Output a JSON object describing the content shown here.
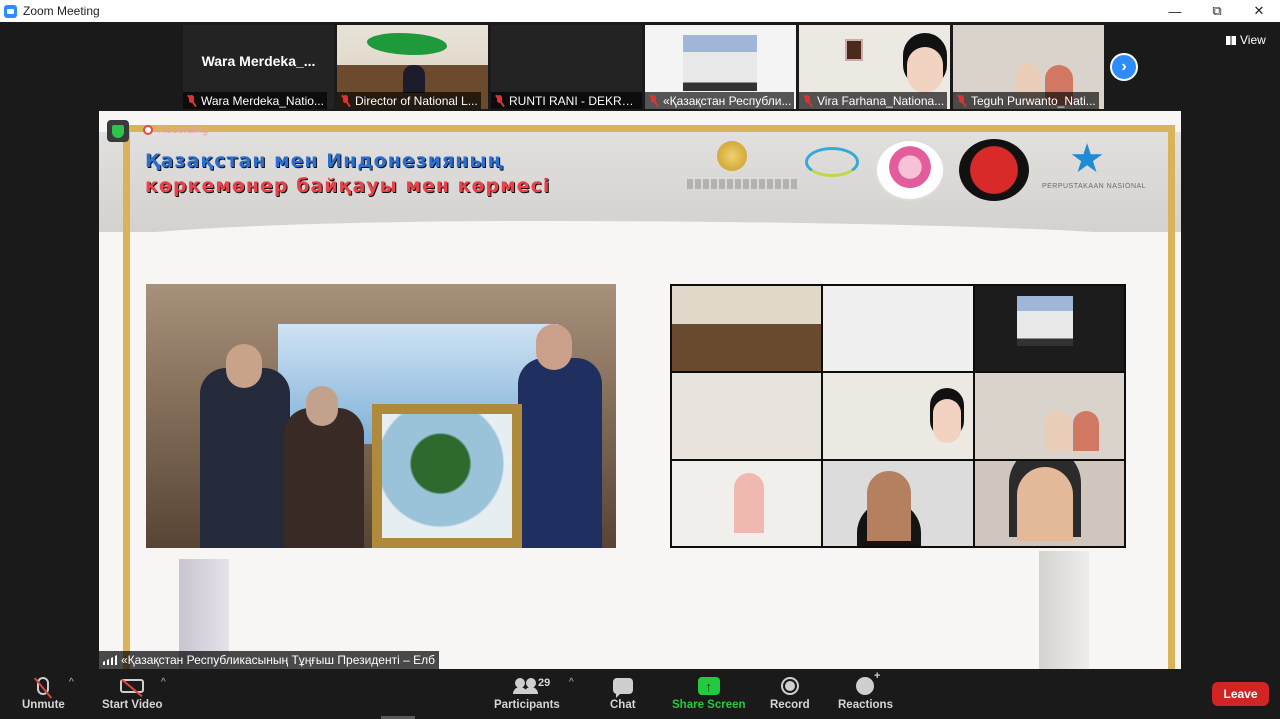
{
  "window": {
    "title": "Zoom Meeting",
    "minimize": "—",
    "restore": "⧉",
    "close": "✕"
  },
  "view": {
    "label": "View",
    "icon": "grid-icon"
  },
  "participants_strip": [
    {
      "name": "Wara Merdeka_Natio...",
      "display_name": "Wara Merdeka_...",
      "video": false
    },
    {
      "name": "Director of National L...",
      "video": true
    },
    {
      "name": "RUNTI RANI - DEKRA...",
      "video": false
    },
    {
      "name": "«Қазақстан Республи...",
      "video": true
    },
    {
      "name": "Vira Farhana_Nationa...",
      "video": true
    },
    {
      "name": "Teguh Purwanto_Nati...",
      "video": true
    }
  ],
  "next_page_icon": "chevron-right-icon",
  "recording": {
    "label": "Recording",
    "icon": "record-dot-icon"
  },
  "encryption_icon": "shield-check-icon",
  "shared_screen": {
    "headline_line1": "Қазақстан мен Индонезияның",
    "headline_line2": "көркемөнер байқауы мен көрмесі",
    "partner_logo_text": "PERPUSTAKAAN NASIONAL",
    "logos": [
      "kazakhstan-emblem-icon",
      "swirl-logo-icon",
      "flower-logo-icon",
      "garuda-seal-icon",
      "star-logo-icon"
    ]
  },
  "active_speaker": {
    "name": "«Қазақстан Республикасының Тұңғыш Президенті – Елб"
  },
  "toolbar": {
    "unmute": "Unmute",
    "start_video": "Start Video",
    "participants": "Participants",
    "participants_count": "29",
    "chat": "Chat",
    "share_screen": "Share Screen",
    "record": "Record",
    "reactions": "Reactions",
    "leave": "Leave",
    "caret": "^"
  },
  "colors": {
    "accent": "#2d8cff",
    "share_green": "#23c93f",
    "leave_red": "#d12424",
    "muted_red": "#e0453a"
  }
}
